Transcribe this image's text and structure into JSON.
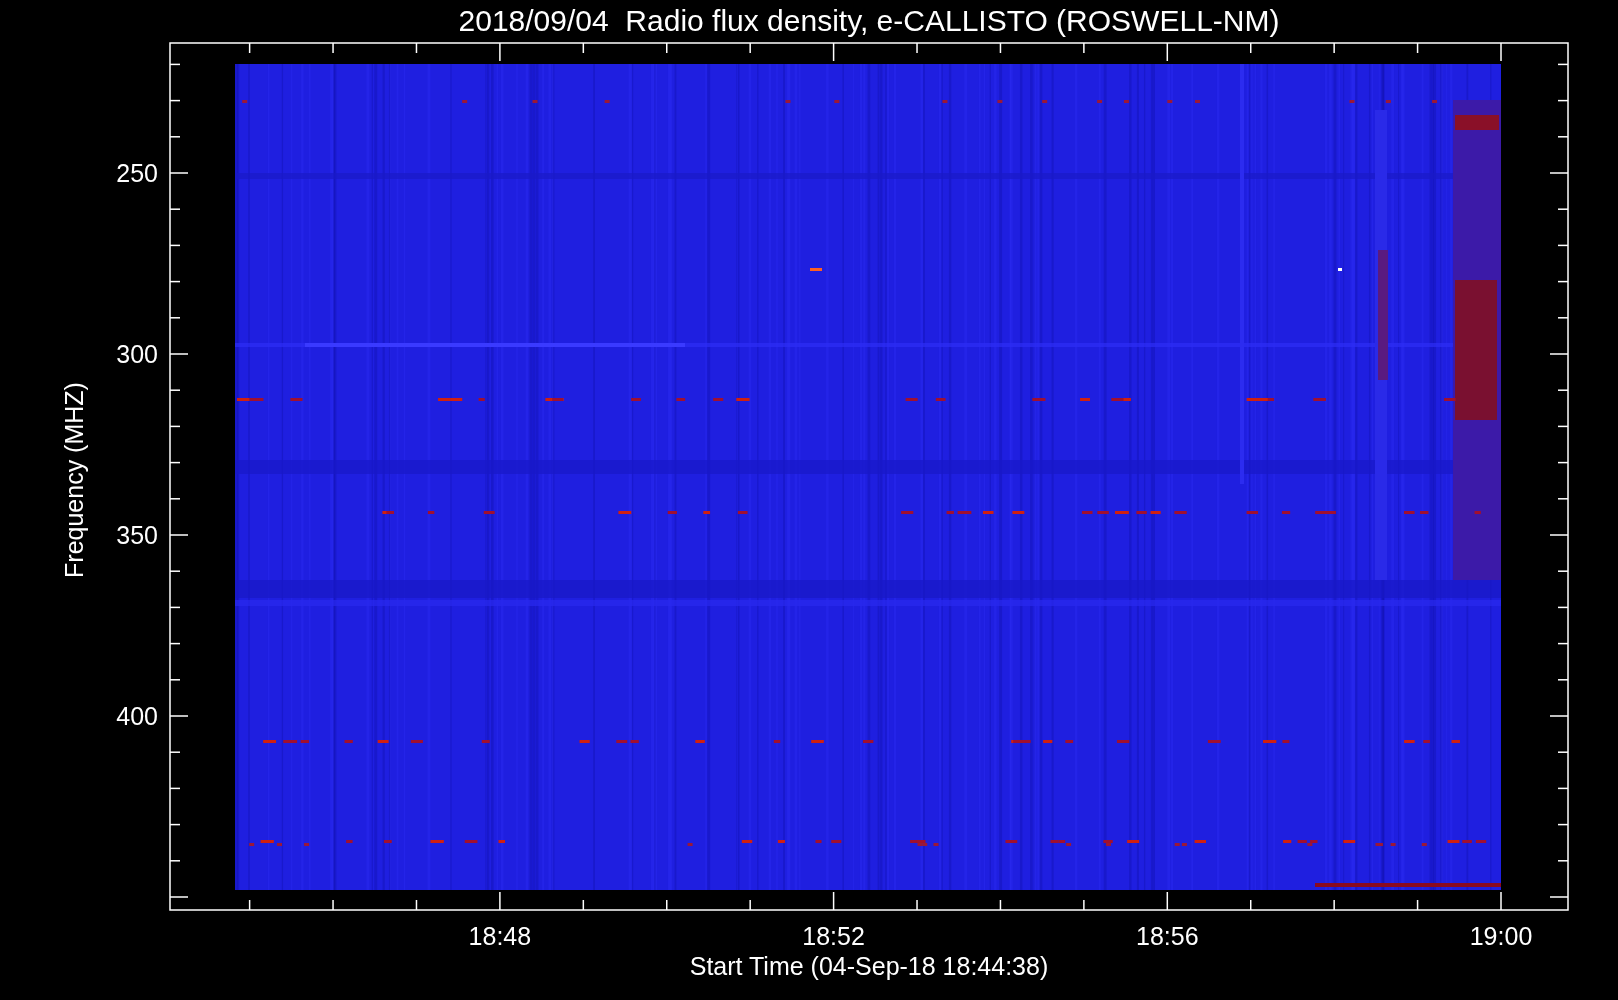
{
  "plot": {
    "title": "2018/09/04  Radio flux density, e-CALLISTO (ROSWELL-NM)",
    "x_axis": {
      "label": "Start Time (04-Sep-18 18:44:38)",
      "ticks": [
        "18:48",
        "18:52",
        "18:56",
        "19:00"
      ]
    },
    "y_axis": {
      "label": "Frequency (MHZ)",
      "ticks": [
        "250",
        "300",
        "350",
        "400"
      ]
    }
  }
}
